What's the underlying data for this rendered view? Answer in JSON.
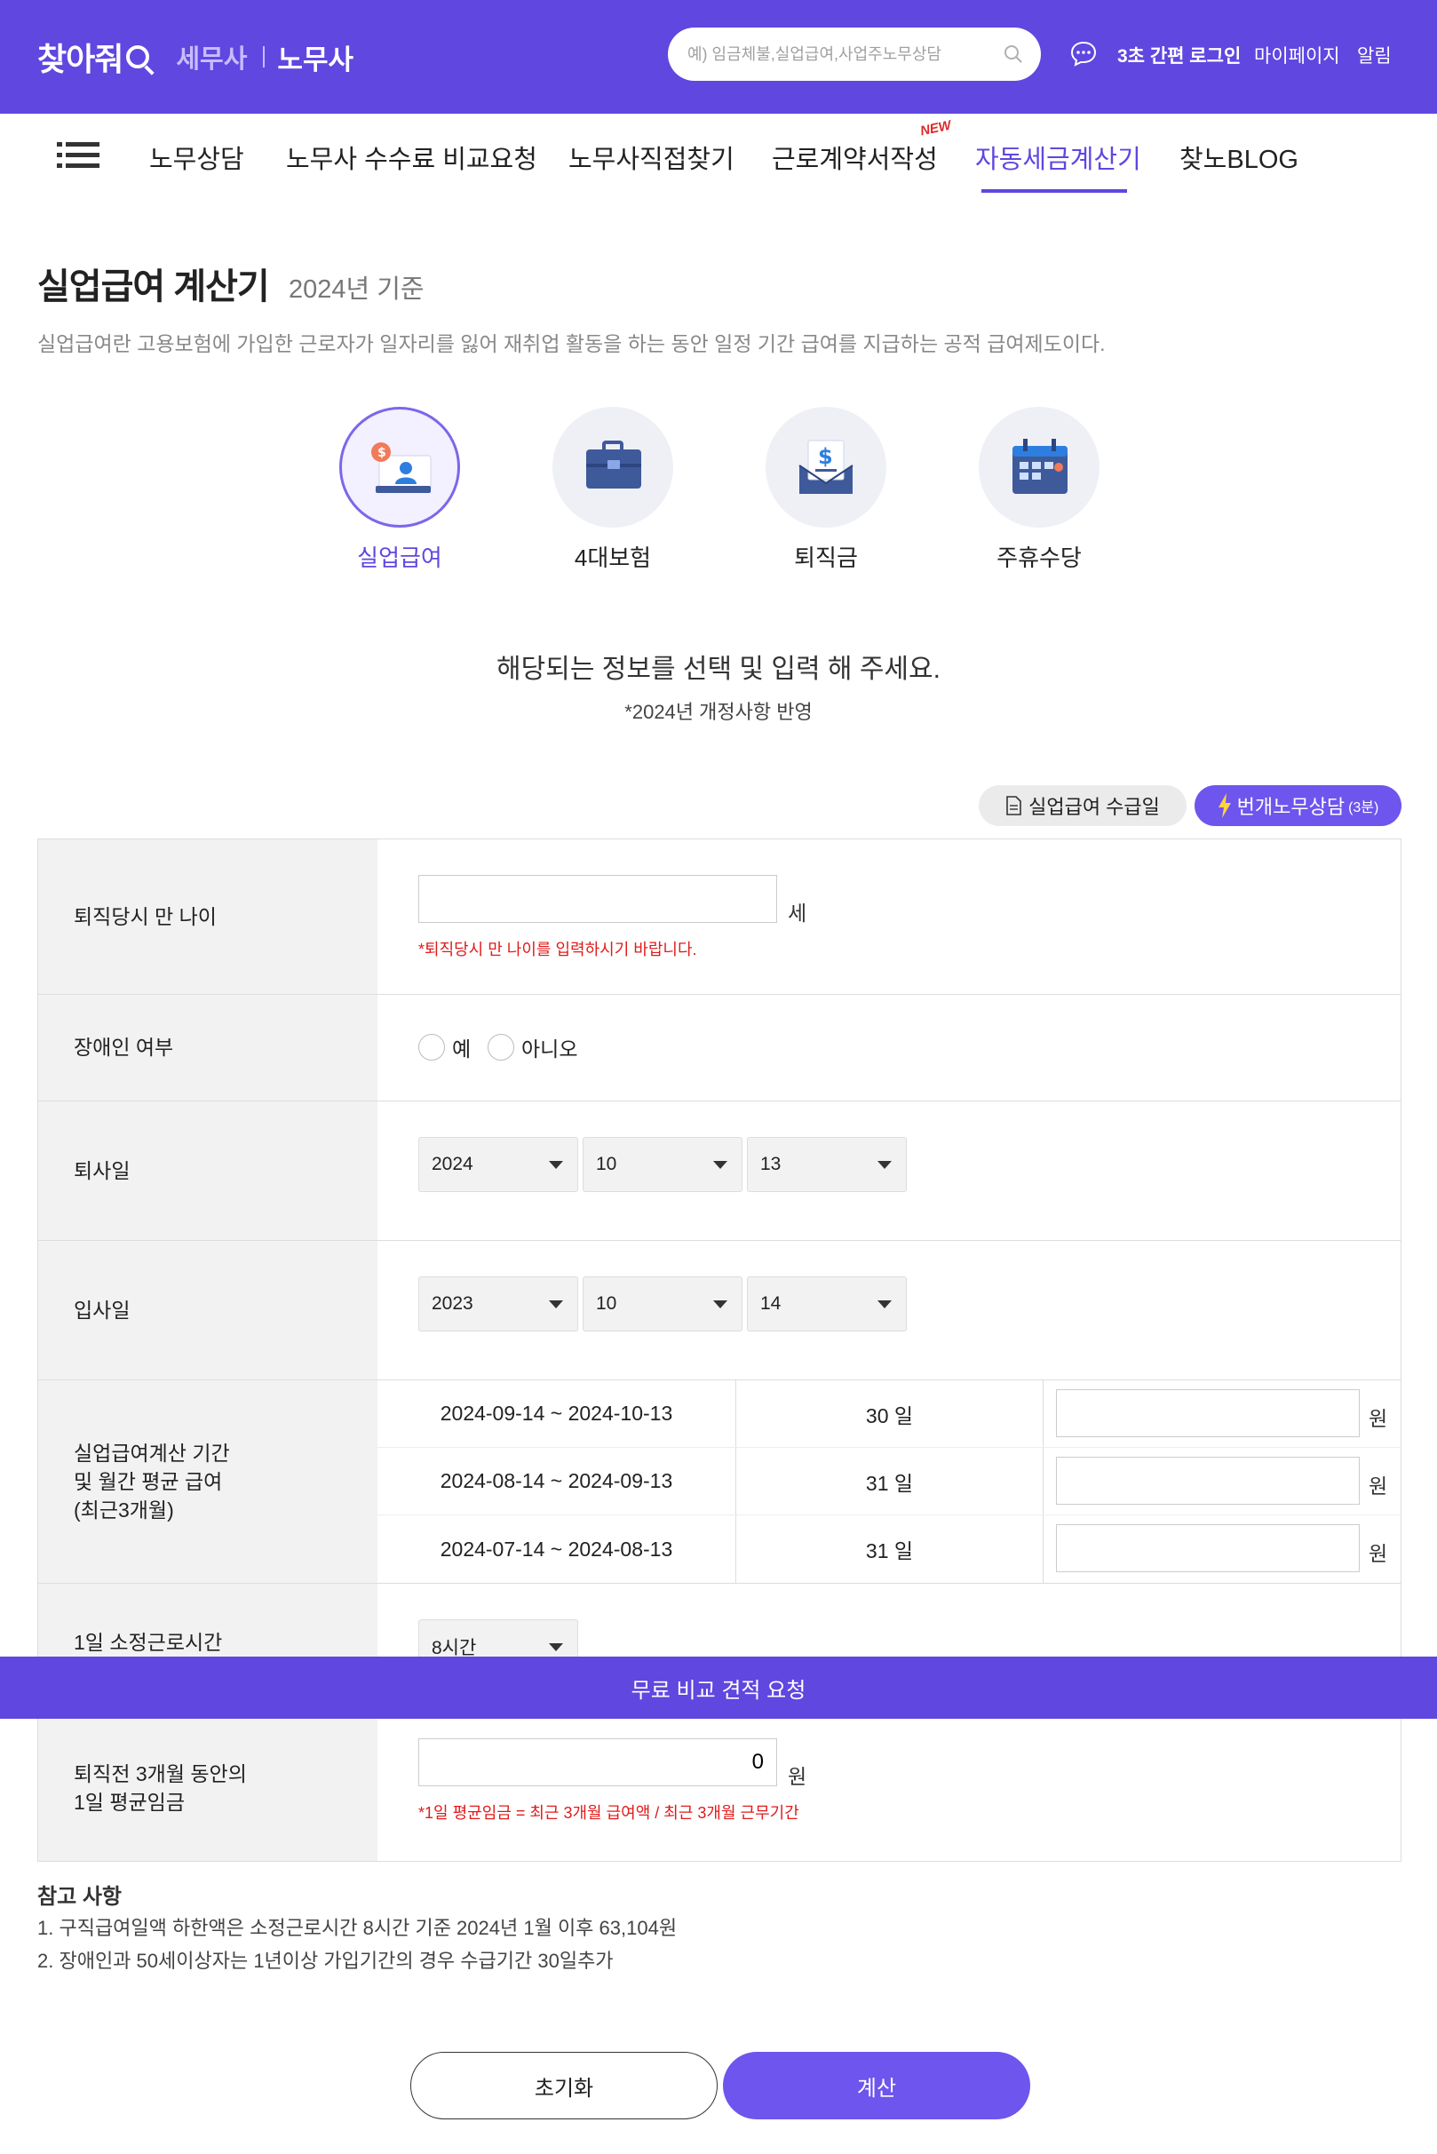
{
  "header": {
    "logo_main": "찾아줘",
    "logo_tax": "세무사",
    "logo_labor": "노무사",
    "search_placeholder": "예) 임금체불,실업급여,사업주노무상담",
    "login": "3초 간편 로그인",
    "mypage": "마이페이지",
    "alarm": "알림",
    "colors": {
      "brand": "#5f47e0",
      "accent": "#6d55ee",
      "error": "#e01b1b"
    }
  },
  "nav": {
    "items": [
      "노무상담",
      "노무사 수수료 비교요청",
      "노무사직접찾기",
      "근로계약서작성",
      "자동세금계산기",
      "찾노BLOG"
    ],
    "new_badge": "NEW",
    "active": "자동세금계산기"
  },
  "page": {
    "title": "실업급여 계산기",
    "title_sub": "2024년 기준",
    "description": "실업급여란 고용보험에 가입한 근로자가 일자리를 잃어 재취업 활동을 하는 동안 일정 기간 급여를 지급하는 공적 급여제도이다."
  },
  "calculators": [
    {
      "label": "실업급여",
      "icon": "unemployment-icon",
      "active": true
    },
    {
      "label": "4대보험",
      "icon": "briefcase-icon",
      "active": false
    },
    {
      "label": "퇴직금",
      "icon": "envelope-dollar-icon",
      "active": false
    },
    {
      "label": "주휴수당",
      "icon": "calendar-icon",
      "active": false
    }
  ],
  "guide": {
    "main": "해당되는 정보를 선택 및 입력 해 주세요.",
    "sub": "*2024년 개정사항 반영"
  },
  "actions": {
    "pay_date": "실업급여 수급일",
    "quick_consult": "번개노무상담",
    "quick_consult_time": "(3분)"
  },
  "form": {
    "age": {
      "label": "퇴직당시 만 나이",
      "value": "",
      "unit": "세",
      "error": "*퇴직당시 만 나이를 입력하시기 바랍니다."
    },
    "disabled": {
      "label": "장애인 여부",
      "options": [
        "예",
        "아니오"
      ]
    },
    "leave_date": {
      "label": "퇴사일",
      "year": "2024",
      "month": "10",
      "day": "13"
    },
    "join_date": {
      "label": "입사일",
      "year": "2023",
      "month": "10",
      "day": "14"
    },
    "period": {
      "label_line1": "실업급여계산 기간",
      "label_line2": "및 월간 평균 급여",
      "label_line3": "(최근3개월)",
      "rows": [
        {
          "range": "2024-09-14 ~ 2024-10-13",
          "days": "30 일",
          "amount": "",
          "unit": "원"
        },
        {
          "range": "2024-08-14 ~ 2024-09-13",
          "days": "31 일",
          "amount": "",
          "unit": "원"
        },
        {
          "range": "2024-07-14 ~ 2024-08-13",
          "days": "31 일",
          "amount": "",
          "unit": "원"
        }
      ]
    },
    "work_hours": {
      "label": "1일 소정근로시간",
      "value": "8시간"
    },
    "avg_wage": {
      "label_line1": "퇴직전 3개월 동안의",
      "label_line2": "1일 평균임금",
      "value": "0",
      "unit": "원",
      "note": "*1일 평균임금 = 최근 3개월 급여액 / 최근 3개월 근무기간"
    }
  },
  "banner": "무료 비교 견적 요청",
  "notes": {
    "title": "참고 사항",
    "items": [
      "1. 구직급여일액 하한액은 소정근로시간 8시간 기준 2024년 1월 이후 63,104원",
      "2. 장애인과 50세이상자는 1년이상 가입기간의 경우 수급기간 30일추가"
    ]
  },
  "buttons": {
    "reset": "초기화",
    "calculate": "계산"
  }
}
